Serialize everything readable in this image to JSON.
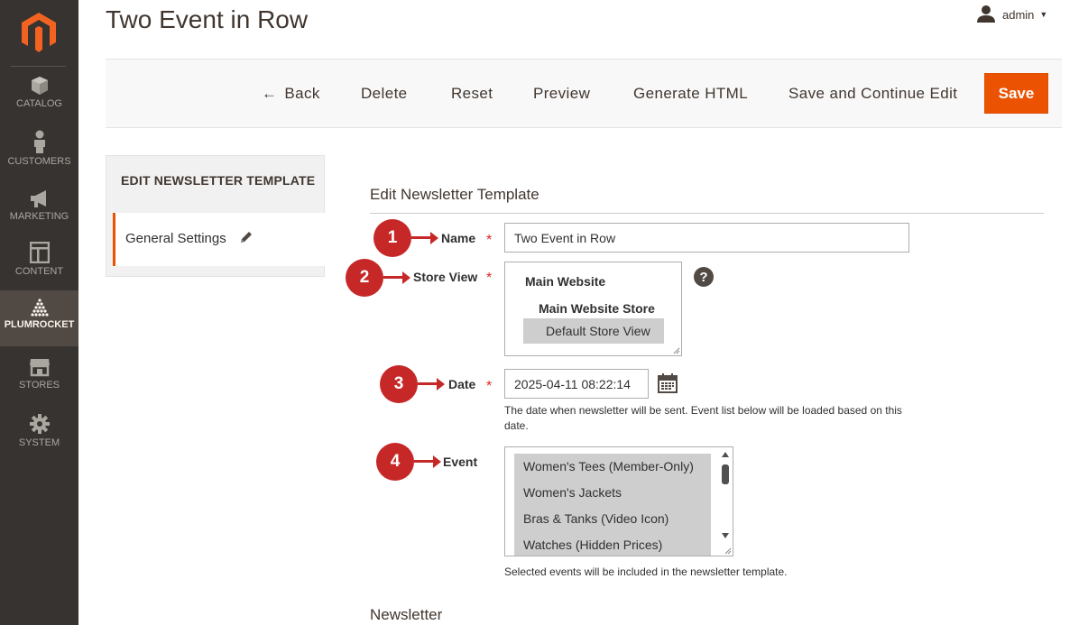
{
  "nav": {
    "items": [
      {
        "label": "CATALOG",
        "icon": "cube-icon"
      },
      {
        "label": "CUSTOMERS",
        "icon": "person-icon"
      },
      {
        "label": "MARKETING",
        "icon": "megaphone-icon"
      },
      {
        "label": "CONTENT",
        "icon": "layout-icon"
      },
      {
        "label": "PLUMROCKET",
        "icon": "plumrocket-icon"
      },
      {
        "label": "STORES",
        "icon": "storefront-icon"
      },
      {
        "label": "SYSTEM",
        "icon": "gear-icon"
      }
    ],
    "active": "PLUMROCKET"
  },
  "header": {
    "title": "Two Event in Row",
    "user": "admin"
  },
  "toolbar": {
    "back": "Back",
    "delete": "Delete",
    "reset": "Reset",
    "preview": "Preview",
    "generate_html": "Generate HTML",
    "save_continue": "Save and Continue Edit",
    "save": "Save"
  },
  "tabs": {
    "title": "EDIT NEWSLETTER TEMPLATE",
    "items": [
      {
        "label": "General Settings"
      }
    ]
  },
  "form": {
    "section_title": "Edit Newsletter Template",
    "name": {
      "label": "Name",
      "value": "Two Event in Row",
      "badge": "1"
    },
    "store_view": {
      "label": "Store View",
      "badge": "2",
      "options": [
        "Main Website",
        "Main Website Store",
        "Default Store View"
      ],
      "selected": "Default Store View",
      "help": "?"
    },
    "date": {
      "label": "Date",
      "value": "2025-04-11 08:22:14",
      "badge": "3",
      "note": "The date when newsletter will be sent. Event list below will be loaded based on this date."
    },
    "event": {
      "label": "Event",
      "badge": "4",
      "options": [
        "Women's Tees (Member-Only)",
        "Women's Jackets",
        "Bras & Tanks (Video Icon)",
        "Watches (Hidden Prices)"
      ],
      "note": "Selected events will be included in the newsletter template."
    },
    "required_mark": "*"
  },
  "newsletter_section": {
    "title": "Newsletter"
  },
  "colors": {
    "accent": "#eb5202",
    "nav_bg": "#373330",
    "nav_active": "#514943",
    "badge_red": "#c62828"
  }
}
